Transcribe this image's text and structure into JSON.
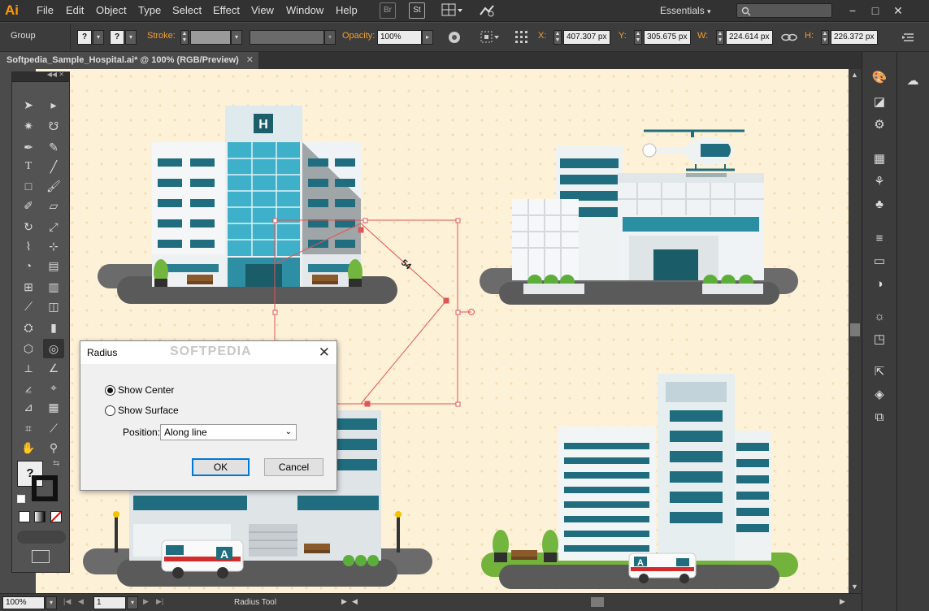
{
  "app": {
    "logo": "Ai"
  },
  "menu": [
    "File",
    "Edit",
    "Object",
    "Type",
    "Select",
    "Effect",
    "View",
    "Window",
    "Help"
  ],
  "menu_icons": {
    "br": "Br",
    "st": "St"
  },
  "workspace": "Essentials",
  "control": {
    "selection": "Group",
    "stroke_label": "Stroke:",
    "opacity_label": "Opacity:",
    "opacity_value": "100%",
    "x_label": "X:",
    "x_value": "407.307 px",
    "y_label": "Y:",
    "y_value": "305.675 px",
    "w_label": "W:",
    "w_value": "224.614 px",
    "h_label": "H:",
    "h_value": "226.372 px",
    "fill_q": "?",
    "stroke_q": "?"
  },
  "document_tab": {
    "title": "Softpedia_Sample_Hospital.ai* @ 100% (RGB/Preview)",
    "close": "✕"
  },
  "artwork": {
    "hospital_sign": "H",
    "ambulance_letter": "A",
    "measure_label": "54"
  },
  "dialog": {
    "title": "Radius",
    "close": "✕",
    "option_center": "Show Center",
    "option_surface": "Show Surface",
    "selected": "Show Center",
    "position_label": "Position:",
    "position_value": "Along line",
    "ok": "OK",
    "cancel": "Cancel",
    "watermark": "SOFTPEDIA"
  },
  "toolbox": {
    "fill_stroke_q": "?"
  },
  "status": {
    "zoom": "100%",
    "page": "1",
    "tool": "Radius Tool"
  },
  "colors": {
    "accent_orange": "#f0a030",
    "ui_dark": "#323232",
    "canvas_bg": "#fdf1d8",
    "teal": "#1c6f80",
    "selection_red": "#e05555"
  }
}
